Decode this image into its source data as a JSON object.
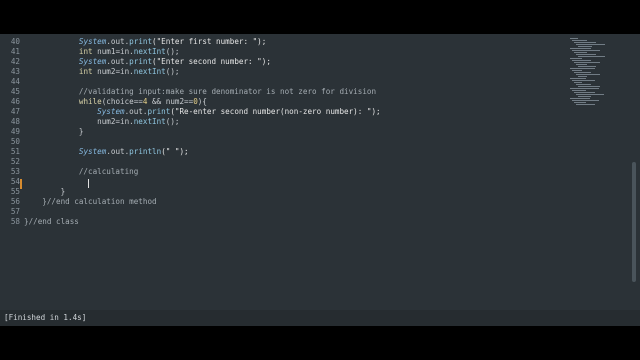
{
  "editor": {
    "lines": [
      {
        "num": "40",
        "tokens": [
          {
            "t": "            ",
            "c": "tok-op"
          },
          {
            "t": "System",
            "c": "tok-class"
          },
          {
            "t": ".out.",
            "c": "tok-op"
          },
          {
            "t": "print",
            "c": "tok-member"
          },
          {
            "t": "(\"Enter first number: \");",
            "c": "tok-str"
          }
        ]
      },
      {
        "num": "41",
        "tokens": [
          {
            "t": "            ",
            "c": "tok-op"
          },
          {
            "t": "int",
            "c": "tok-type"
          },
          {
            "t": " num1=in.",
            "c": "tok-op"
          },
          {
            "t": "nextInt",
            "c": "tok-member"
          },
          {
            "t": "();",
            "c": "tok-op"
          }
        ]
      },
      {
        "num": "42",
        "tokens": [
          {
            "t": "            ",
            "c": "tok-op"
          },
          {
            "t": "System",
            "c": "tok-class"
          },
          {
            "t": ".out.",
            "c": "tok-op"
          },
          {
            "t": "print",
            "c": "tok-member"
          },
          {
            "t": "(\"Enter second number: \");",
            "c": "tok-str"
          }
        ]
      },
      {
        "num": "43",
        "tokens": [
          {
            "t": "            ",
            "c": "tok-op"
          },
          {
            "t": "int",
            "c": "tok-type"
          },
          {
            "t": " num2=in.",
            "c": "tok-op"
          },
          {
            "t": "nextInt",
            "c": "tok-member"
          },
          {
            "t": "();",
            "c": "tok-op"
          }
        ]
      },
      {
        "num": "44",
        "tokens": []
      },
      {
        "num": "45",
        "tokens": [
          {
            "t": "            //validating input:make sure denominator is not zero for division",
            "c": "tok-comment"
          }
        ]
      },
      {
        "num": "46",
        "tokens": [
          {
            "t": "            ",
            "c": "tok-op"
          },
          {
            "t": "while",
            "c": "tok-kw"
          },
          {
            "t": "(choice==",
            "c": "tok-op"
          },
          {
            "t": "4",
            "c": "tok-num"
          },
          {
            "t": " && num2==",
            "c": "tok-op"
          },
          {
            "t": "0",
            "c": "tok-num"
          },
          {
            "t": "){",
            "c": "tok-op"
          }
        ]
      },
      {
        "num": "47",
        "tokens": [
          {
            "t": "                ",
            "c": "tok-op"
          },
          {
            "t": "System",
            "c": "tok-class"
          },
          {
            "t": ".out.",
            "c": "tok-op"
          },
          {
            "t": "print",
            "c": "tok-member"
          },
          {
            "t": "(\"Re-enter second number(non-zero number): \");",
            "c": "tok-str"
          }
        ]
      },
      {
        "num": "48",
        "tokens": [
          {
            "t": "                num2=in.",
            "c": "tok-op"
          },
          {
            "t": "nextInt",
            "c": "tok-member"
          },
          {
            "t": "();",
            "c": "tok-op"
          }
        ]
      },
      {
        "num": "49",
        "tokens": [
          {
            "t": "            }",
            "c": "tok-op"
          }
        ]
      },
      {
        "num": "50",
        "tokens": []
      },
      {
        "num": "51",
        "tokens": [
          {
            "t": "            ",
            "c": "tok-op"
          },
          {
            "t": "System",
            "c": "tok-class"
          },
          {
            "t": ".out.",
            "c": "tok-op"
          },
          {
            "t": "println",
            "c": "tok-member"
          },
          {
            "t": "(\" \");",
            "c": "tok-str"
          }
        ]
      },
      {
        "num": "52",
        "tokens": []
      },
      {
        "num": "53",
        "tokens": [
          {
            "t": "            //calculating",
            "c": "tok-comment"
          }
        ]
      },
      {
        "num": "54",
        "tokens": []
      },
      {
        "num": "55",
        "tokens": [
          {
            "t": "        }",
            "c": "tok-op"
          }
        ]
      },
      {
        "num": "56",
        "tokens": [
          {
            "t": "    }//end calculation method",
            "c": "tok-comment"
          }
        ]
      },
      {
        "num": "57",
        "tokens": []
      },
      {
        "num": "58",
        "tokens": [
          {
            "t": "}//end class",
            "c": "tok-comment"
          }
        ]
      }
    ],
    "cursor_line": "54",
    "modified_line": "54"
  },
  "console": {
    "status_text": "[Finished in 1.4s]"
  },
  "colors": {
    "editor_bg": "#2b3237",
    "console_bg": "#262c30",
    "change_marker": "#d68b2f"
  }
}
